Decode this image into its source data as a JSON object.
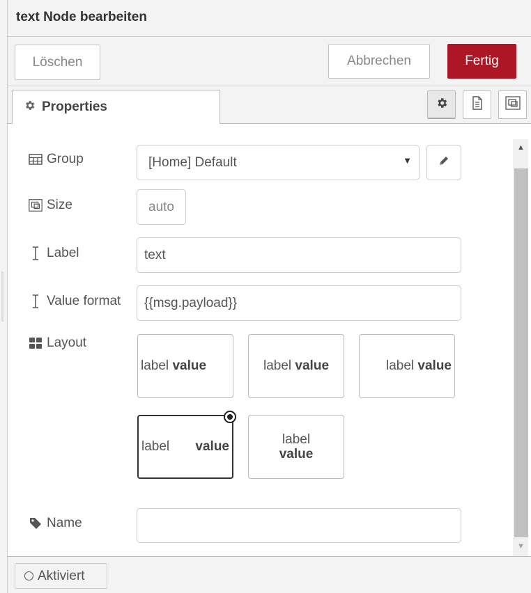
{
  "title": "text Node bearbeiten",
  "buttons": {
    "delete": "Löschen",
    "cancel": "Abbrechen",
    "done": "Fertig"
  },
  "tabs": {
    "properties": "Properties"
  },
  "tab_buttons": [
    "gear-icon",
    "description-icon",
    "appearance-icon"
  ],
  "fields": {
    "group": {
      "label": "Group",
      "value": "[Home] Default"
    },
    "size": {
      "label": "Size",
      "value": "auto"
    },
    "label": {
      "label": "Label",
      "value": "text"
    },
    "format": {
      "label": "Value format",
      "value": "{{msg.payload}}"
    },
    "layout": {
      "label": "Layout"
    },
    "name": {
      "label": "Name",
      "value": ""
    }
  },
  "layouts": [
    {
      "label": "label",
      "value": "value",
      "align": "row-left"
    },
    {
      "label": "label",
      "value": "value",
      "align": "row-center"
    },
    {
      "label": "label",
      "value": "value",
      "align": "row-right"
    },
    {
      "label": "label",
      "value": "value",
      "align": "row-spread",
      "selected": true
    },
    {
      "label": "label",
      "value": "value",
      "align": "column-center"
    }
  ],
  "footer": {
    "toggle": "Aktiviert"
  },
  "colors": {
    "primary": "#ad1625",
    "border": "#cccccc",
    "background": "#f3f3f3"
  }
}
